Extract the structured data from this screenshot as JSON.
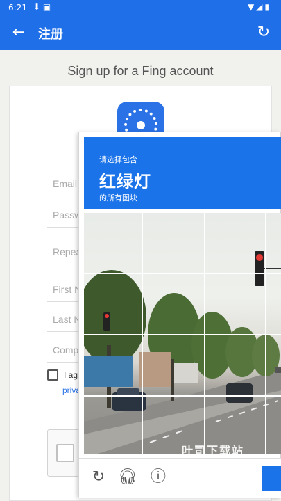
{
  "status_bar": {
    "time": "6:21",
    "left_icons": "⬇ ▣",
    "right_icons": "▼◢▮"
  },
  "app_bar": {
    "title": "注册",
    "back_icon": "arrow-left",
    "refresh_icon": "refresh"
  },
  "page": {
    "heading": "Sign up for a Fing account"
  },
  "form": {
    "email_placeholder": "Email",
    "password_placeholder": "Passw",
    "repeat_placeholder": "Repea",
    "first_name_placeholder": "First N",
    "last_name_placeholder": "Last N",
    "company_placeholder": "Comp",
    "terms_text": "I agr",
    "privacy_link": "priva"
  },
  "captcha": {
    "instruction": "请选择包含",
    "target": "红绿灯",
    "sub_instruction": "的所有图块",
    "colors": {
      "header": "#1a73e8"
    }
  },
  "watermark": "叶司下载站"
}
